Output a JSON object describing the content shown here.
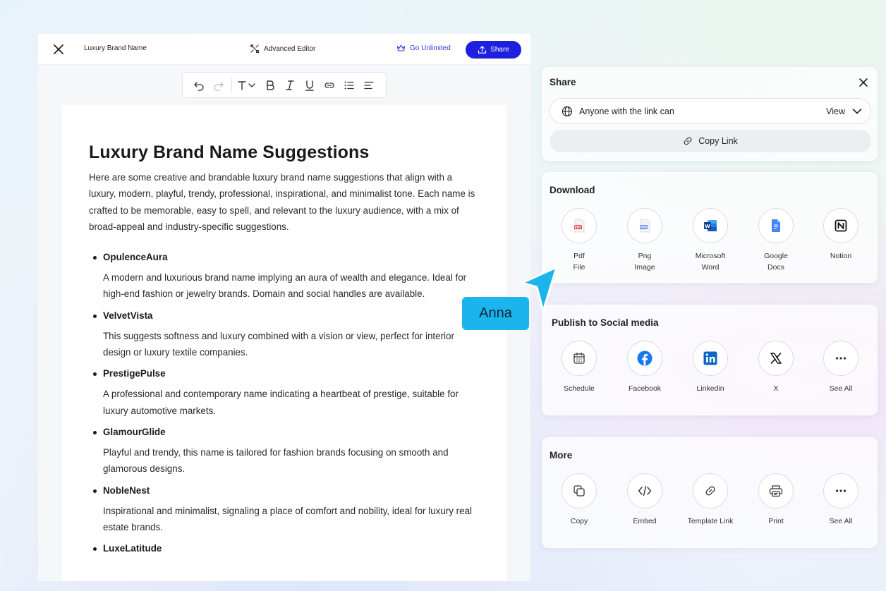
{
  "editor": {
    "doc_title": "Luxury Brand Name",
    "advanced_editor_label": "Advanced Editor",
    "go_unlimited_label": "Go Unlimited",
    "share_label": "Share",
    "toolbar": [
      "undo-icon",
      "redo-icon",
      "text-style-icon",
      "bold-icon",
      "italic-icon",
      "underline-icon",
      "link-icon",
      "bullet-list-icon",
      "align-left-icon"
    ]
  },
  "document": {
    "heading": "Luxury Brand Name Suggestions",
    "intro": "Here are some creative and brandable luxury brand name suggestions that align with a luxury, modern, playful, trendy, professional, inspirational, and minimalist tone. Each name is crafted to be memorable, easy to spell, and relevant to the luxury audience, with a mix of broad-appeal and industry-specific suggestions.",
    "items": [
      {
        "name": "OpulenceAura",
        "desc": "A modern and luxurious brand name implying an aura of wealth and elegance. Ideal for high-end fashion or jewelry brands. Domain and social handles are available."
      },
      {
        "name": "VelvetVista",
        "desc": "This suggests softness and luxury combined with a vision or view, perfect for interior design or luxury textile companies."
      },
      {
        "name": "PrestigePulse",
        "desc": "A professional and contemporary name indicating a heartbeat of prestige, suitable for luxury automotive markets."
      },
      {
        "name": "GlamourGlide",
        "desc": "Playful and trendy, this name is tailored for fashion brands focusing on smooth and glamorous designs."
      },
      {
        "name": "NobleNest",
        "desc": "Inspirational and minimalist, signaling a place of comfort and nobility, ideal for luxury real estate brands."
      },
      {
        "name": "LuxeLatitude",
        "desc": ""
      }
    ]
  },
  "share_panel": {
    "title": "Share",
    "access_label": "Anyone with the link can",
    "access_mode": "View",
    "copy_link_label": "Copy Link"
  },
  "download_panel": {
    "title": "Download",
    "options": [
      {
        "label": "Pdf\nFile",
        "line1": "Pdf",
        "line2": "File",
        "icon": "pdf-icon"
      },
      {
        "label": "Png Image",
        "line1": "Png",
        "line2": "Image",
        "icon": "png-icon"
      },
      {
        "label": "Microsoft Word",
        "line1": "Microsoft",
        "line2": "Word",
        "icon": "word-icon"
      },
      {
        "label": "Google Docs",
        "line1": "Google",
        "line2": "Docs",
        "icon": "google-docs-icon"
      },
      {
        "label": "Notion",
        "line1": "Notion",
        "line2": "",
        "icon": "notion-icon"
      }
    ]
  },
  "social_panel": {
    "title": "Publish to Social media",
    "options": [
      {
        "label": "Schedule",
        "icon": "calendar-icon"
      },
      {
        "label": "Facebook",
        "icon": "facebook-icon"
      },
      {
        "label": "Linkedin",
        "icon": "linkedin-icon"
      },
      {
        "label": "X",
        "icon": "x-icon"
      },
      {
        "label": "See All",
        "icon": "more-icon"
      }
    ]
  },
  "more_panel": {
    "title": "More",
    "options": [
      {
        "label": "Copy",
        "icon": "copy-icon"
      },
      {
        "label": "Embed",
        "icon": "embed-icon"
      },
      {
        "label": "Template Link",
        "icon": "link-icon"
      },
      {
        "label": "Print",
        "icon": "printer-icon"
      },
      {
        "label": "See All",
        "icon": "more-icon"
      }
    ]
  },
  "collaborator": {
    "name": "Anna",
    "color": "#1cb4ec"
  },
  "colors": {
    "primary": "#1f1fe0",
    "facebook": "#1877f2",
    "linkedin": "#0a66c2",
    "word": "#185abd",
    "pdf": "#e5533d"
  }
}
